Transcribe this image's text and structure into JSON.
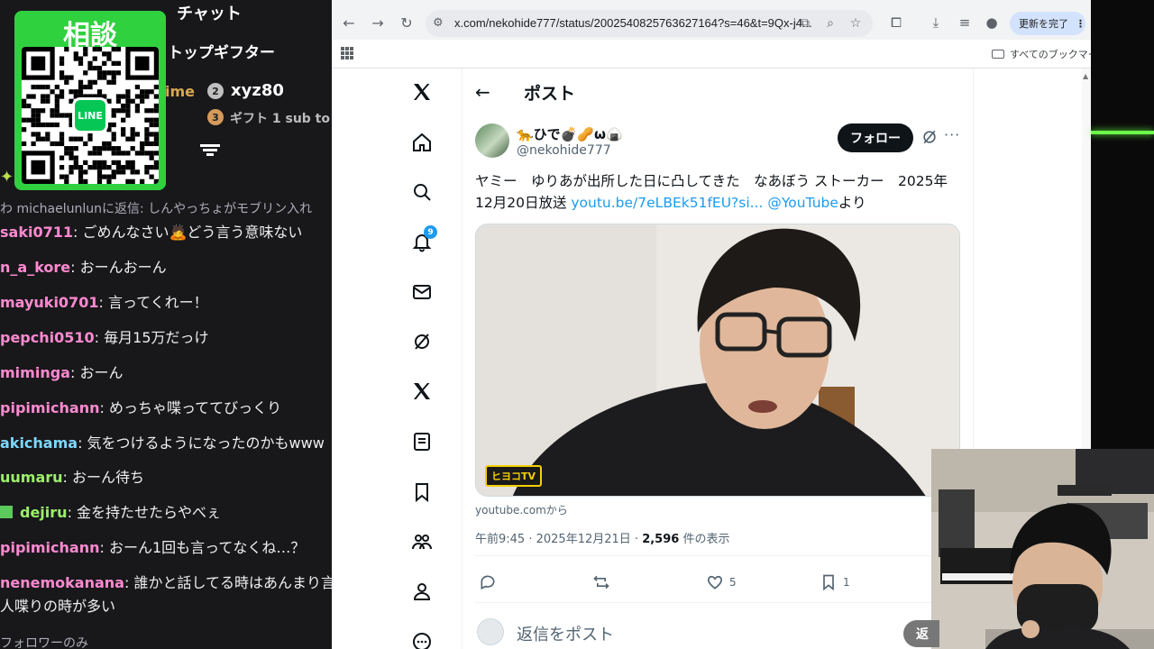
{
  "chat": {
    "title": "チャット",
    "top_gifter_label": "トップギフター",
    "time_fragment": "ime",
    "rank2_number": "2",
    "rank2_name": "xyz80",
    "rank3_number": "3",
    "rank3_text": "ギフト 1 sub to",
    "qr_title": "相談",
    "line_logo_text": "LINE",
    "reply_line": "わ michaelunlunに返信: しんやっちょがモブリン入れ",
    "messages": [
      {
        "user": "saki0711",
        "text": "ごめんなさい🙇どう言う意味ない",
        "color": "#ff8ad0"
      },
      {
        "user": "n_a_kore",
        "text": "おーんおーん",
        "color": "#ff8ad0"
      },
      {
        "user": "mayuki0701",
        "text": "言ってくれー！",
        "color": "#ff8ad0"
      },
      {
        "user": "pepchi0510",
        "text": "毎月15万だっけ",
        "color": "#ff8ad0"
      },
      {
        "user": "miminga",
        "text": "おーん",
        "color": "#ff8ad0"
      },
      {
        "user": "pipimichann",
        "text": "めっちゃ喋っててびっくり",
        "color": "#ff8ad0"
      },
      {
        "user": "akichama",
        "text": "気をつけるようになったのかもwww",
        "color": "#7dd8ff"
      },
      {
        "user": "uumaru",
        "text": "おーん待ち",
        "color": "#9cf06a"
      },
      {
        "user": "dejiru",
        "text": "金を持たせたらやべぇ",
        "color": "#9cf06a"
      },
      {
        "user": "pipimichann",
        "text": "おーん1回も言ってなくね…？",
        "color": "#ff8ad0"
      },
      {
        "user": "nenemokanana",
        "text": "誰かと話してる時はあんまり言わ",
        "color": "#ff8ad0"
      }
    ],
    "continuation": "人喋りの時が多い",
    "followers_only": "フォロワーのみ"
  },
  "browser": {
    "url": "x.com/nekohide777/status/2002540825763627164?s=46&t=9Qx-j4...",
    "update_button": "更新を完了",
    "update_menu": "⋮",
    "all_bookmarks": "すべてのブックマーク"
  },
  "x_sidebar": {
    "notification_count": "9"
  },
  "post": {
    "header_title": "ポスト",
    "display_name": "🐆ひで💣🥜ω🍙",
    "handle": "@nekohide777",
    "follow_button": "フォロー",
    "text_main": "ヤミー　ゆりあが出所した日に凸してきた　なあぼう ストーカー　2025年12月20日放送 ",
    "text_link": "youtu.be/7eLBEk51fEU?si...",
    "text_mention": "@YouTube",
    "text_tail": "より",
    "media_tag": "ヒヨコTV",
    "source": "youtube.comから",
    "time": "午前9:45",
    "date": "2025年12月21日",
    "views_count": "2,596",
    "views_label": "件の表示",
    "reposts": "",
    "likes": "5",
    "bookmarks": "1",
    "reply_placeholder": "返信をポスト"
  },
  "overlay": {
    "reply_button_fragment": "返"
  }
}
